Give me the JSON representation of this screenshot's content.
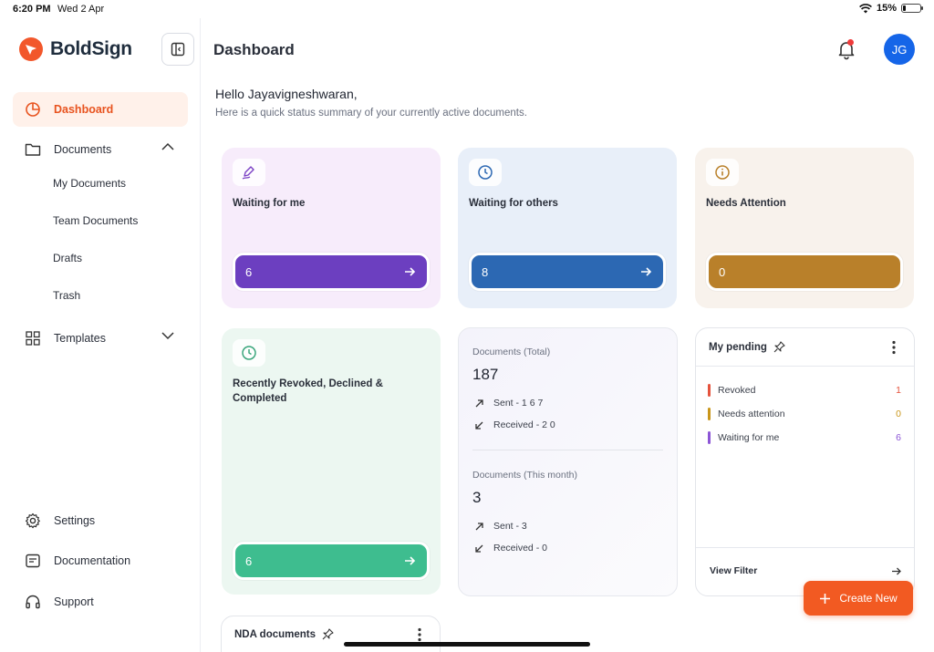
{
  "statusbar": {
    "time": "6:20 PM",
    "date": "Wed 2 Apr",
    "battery": "15%",
    "battery_level": 0.15
  },
  "brand": {
    "name": "BoldSign",
    "color": "#f2572b"
  },
  "sidebar": {
    "dashboard": "Dashboard",
    "documents": "Documents",
    "documents_sub": [
      "My Documents",
      "Team Documents",
      "Drafts",
      "Trash"
    ],
    "templates": "Templates",
    "settings": "Settings",
    "documentation": "Documentation",
    "support": "Support"
  },
  "header": {
    "title": "Dashboard",
    "avatar_initials": "JG"
  },
  "greeting": {
    "title": "Hello Jayavigneshwaran,",
    "subtitle": "Here is a quick status summary of your currently active documents."
  },
  "cards": {
    "waiting_me": {
      "title": "Waiting for me",
      "count": "6",
      "color": "#6c3fc0"
    },
    "waiting_others": {
      "title": "Waiting for others",
      "count": "8",
      "color": "#2c68b3"
    },
    "needs_attention": {
      "title": "Needs Attention",
      "count": "0",
      "color": "#b9802a"
    },
    "revoked": {
      "title": "Recently Revoked, Declined & Completed",
      "count": "6",
      "color": "#3ebd8f"
    }
  },
  "totals": {
    "total_label": "Documents (Total)",
    "total_value": "187",
    "total_sent": "Sent - 1 6 7",
    "total_received": "Received - 2 0",
    "month_label": "Documents (This month)",
    "month_value": "3",
    "month_sent": "Sent - 3",
    "month_received": "Received - 0"
  },
  "pending": {
    "title": "My pending",
    "items": [
      {
        "label": "Revoked",
        "count": "1",
        "color": "#e5533d"
      },
      {
        "label": "Needs attention",
        "count": "0",
        "color": "#c9961a"
      },
      {
        "label": "Waiting for me",
        "count": "6",
        "color": "#8c55d6"
      }
    ],
    "view_filter": "View Filter"
  },
  "nda": {
    "title": "NDA documents"
  },
  "create_button": "Create New"
}
